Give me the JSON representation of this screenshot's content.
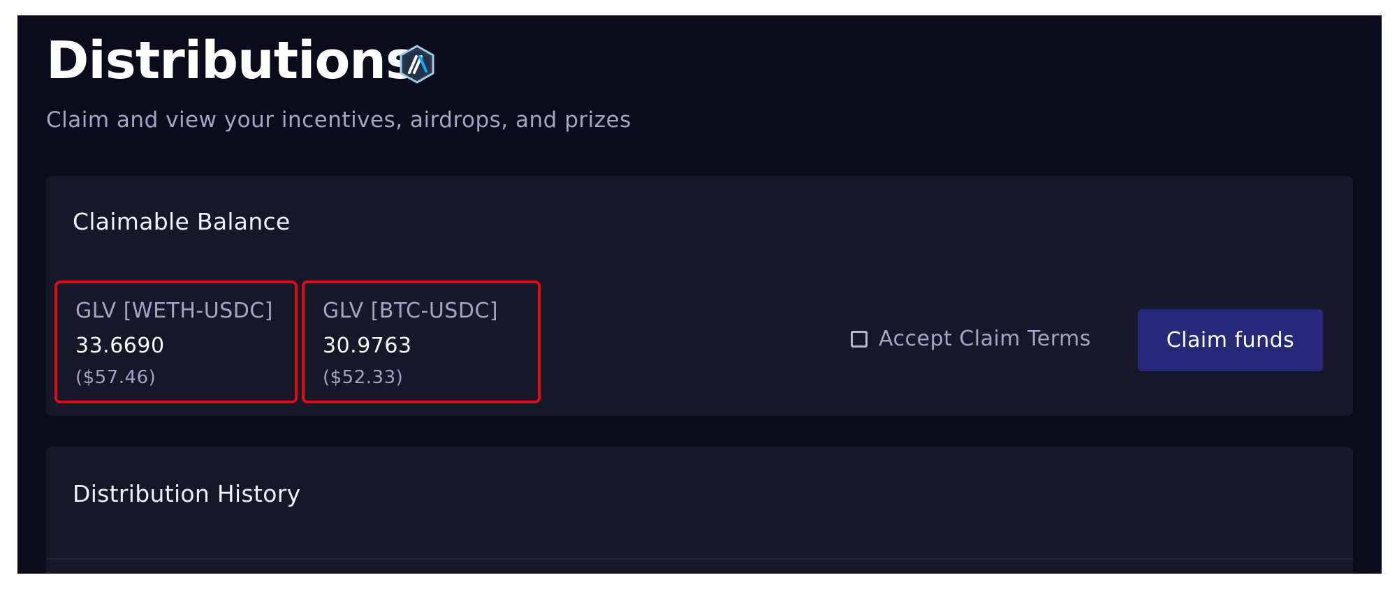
{
  "header": {
    "title": "Distributions",
    "subtitle": "Claim and view your incentives, airdrops, and prizes",
    "network_icon": "arbitrum-icon"
  },
  "claimable_balance": {
    "title": "Claimable Balance",
    "tokens": [
      {
        "name": "GLV [WETH-USDC]",
        "amount": "33.6690",
        "usd": "($57.46)"
      },
      {
        "name": "GLV [BTC-USDC]",
        "amount": "30.9763",
        "usd": "($52.33)"
      }
    ],
    "accept_terms_label": "Accept Claim Terms",
    "accept_terms_checked": false,
    "claim_button_label": "Claim funds"
  },
  "distribution_history": {
    "title": "Distribution History"
  },
  "colors": {
    "background": "#0a0c1b",
    "panel": "#161829",
    "accent_button": "#26297a",
    "highlight": "#e10b16",
    "muted_text": "#a3a5c4"
  }
}
